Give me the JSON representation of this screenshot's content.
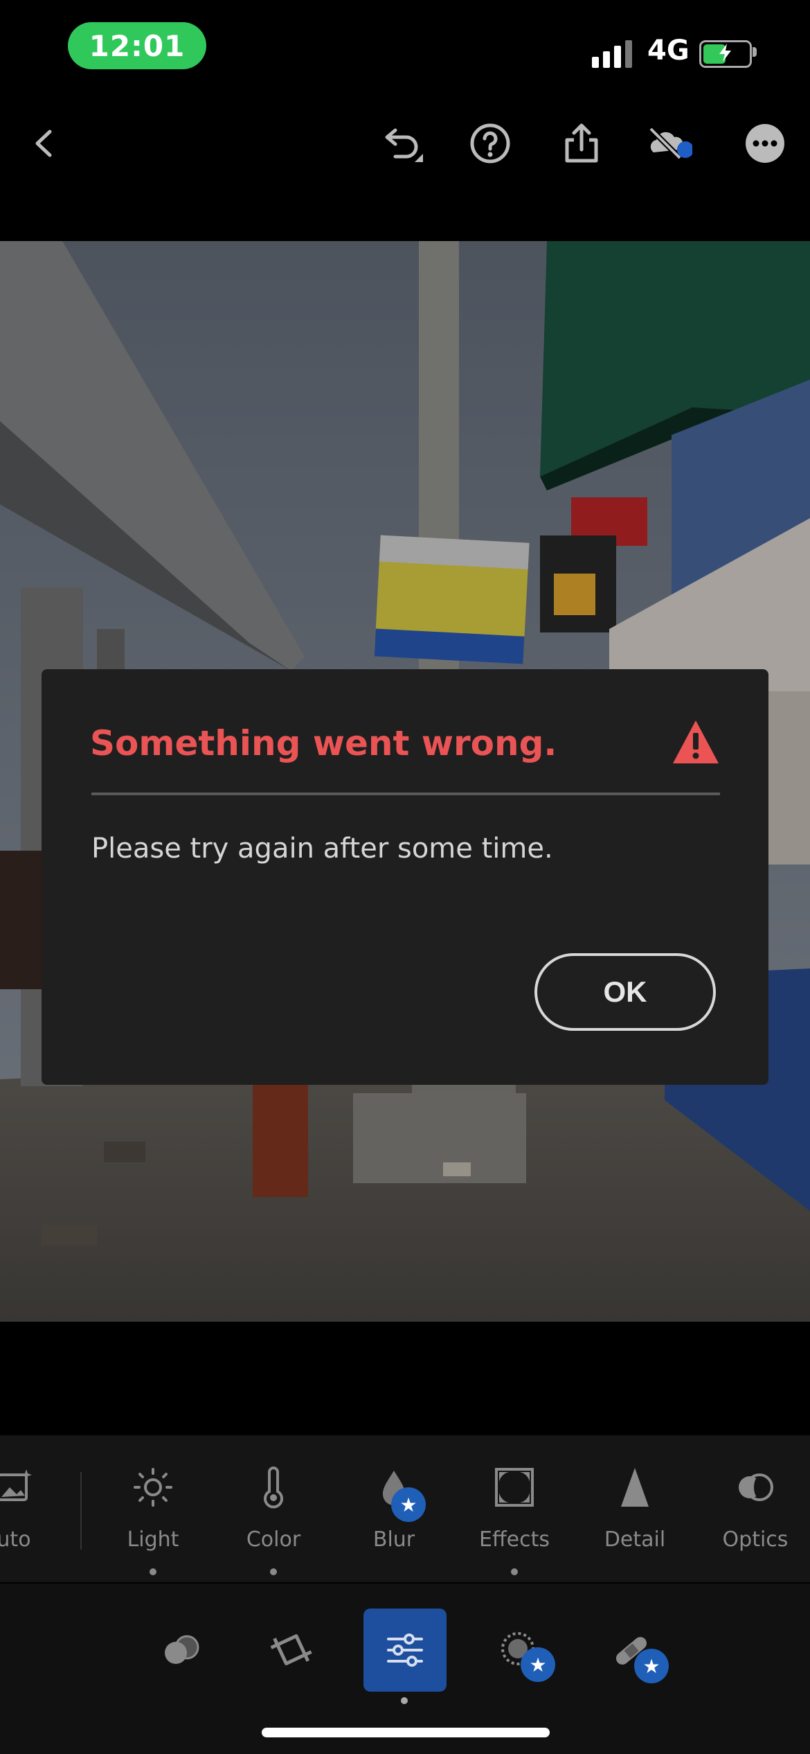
{
  "status_bar": {
    "time": "12:01",
    "network": "4G",
    "battery_level": 0.55,
    "signal_icon": "cellular-signal-icon",
    "battery_icon": "battery-charging-icon"
  },
  "toolbar": {
    "back_icon": "chevron-left-icon",
    "undo_icon": "undo-icon",
    "help_icon": "help-icon",
    "share_icon": "share-icon",
    "cloud_icon": "cloud-off-icon",
    "more_icon": "more-icon"
  },
  "dialog": {
    "title": "Something went wrong.",
    "message": "Please try again after some time.",
    "ok_label": "OK",
    "title_color": "#ea5454"
  },
  "tools": {
    "items": [
      {
        "label": "uto",
        "icon": "auto-icon"
      },
      {
        "label": "Light",
        "icon": "sun-icon"
      },
      {
        "label": "Color",
        "icon": "thermometer-icon"
      },
      {
        "label": "Blur",
        "icon": "droplet-icon"
      },
      {
        "label": "Effects",
        "icon": "vignette-icon"
      },
      {
        "label": "Detail",
        "icon": "triangle-icon"
      },
      {
        "label": "Optics",
        "icon": "lens-icon"
      }
    ]
  },
  "bottom_nav": {
    "items": [
      "presets-icon",
      "crop-icon",
      "edit-sliders-icon",
      "masking-icon",
      "healing-icon"
    ],
    "accent": "#1d4f9e"
  }
}
